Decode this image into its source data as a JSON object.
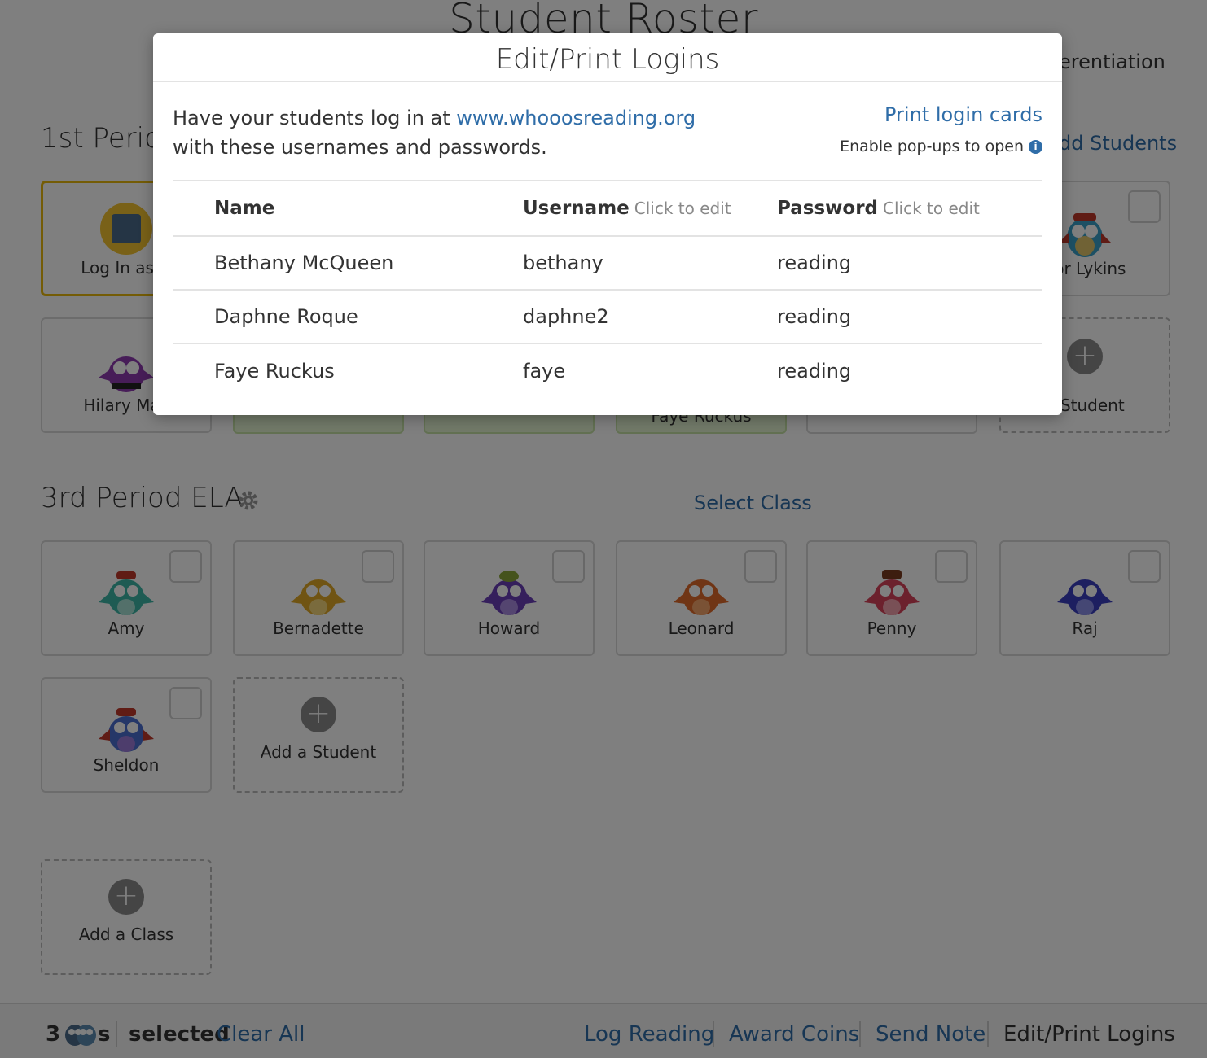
{
  "page": {
    "title": "Student Roster",
    "differentiation_link": "erentiation",
    "add_students_link": "dd Students",
    "select_class_link": "Select Class"
  },
  "classes": [
    {
      "name": "1st Perio",
      "cards": [
        {
          "label": "Log In as D",
          "type": "login-as"
        },
        {
          "label": "dor Lykins",
          "type": "student",
          "owl": "blue-red"
        },
        {
          "label": "Hilary Mac",
          "type": "student",
          "owl": "purple-hat"
        },
        {
          "label": "a Student",
          "type": "add"
        },
        {
          "label": "Faye Ruckus",
          "type": "student-green"
        }
      ]
    },
    {
      "name": "3rd Period ELA",
      "cards": [
        {
          "label": "Amy",
          "type": "student",
          "owl": "teal"
        },
        {
          "label": "Bernadette",
          "type": "student",
          "owl": "yellow"
        },
        {
          "label": "Howard",
          "type": "student",
          "owl": "purple"
        },
        {
          "label": "Leonard",
          "type": "student",
          "owl": "orange"
        },
        {
          "label": "Penny",
          "type": "student",
          "owl": "pink"
        },
        {
          "label": "Raj",
          "type": "student",
          "owl": "blue"
        },
        {
          "label": "Sheldon",
          "type": "student",
          "owl": "blue-red"
        },
        {
          "label": "Add a Student",
          "type": "add"
        }
      ]
    }
  ],
  "add_class_label": "Add a Class",
  "toolbar": {
    "count": "3",
    "owls_suffix": "s",
    "selected_label": "selected",
    "clear_all": "Clear All",
    "actions": [
      "Log Reading",
      "Award Coins",
      "Send Note",
      "Edit/Print Logins"
    ],
    "active_action": "Edit/Print Logins"
  },
  "modal": {
    "title": "Edit/Print Logins",
    "intro_prefix": "Have your students log in at ",
    "intro_link": "www.whooosreading.org",
    "intro_suffix": "with these usernames and passwords.",
    "print_link": "Print login cards",
    "popup_note": "Enable pop-ups to open",
    "info_icon": "info-icon",
    "table": {
      "headers": {
        "name": "Name",
        "username": "Username",
        "password": "Password",
        "edit_hint": "Click to edit"
      },
      "rows": [
        {
          "name": "Bethany McQueen",
          "username": "bethany",
          "password": "reading"
        },
        {
          "name": "Daphne Roque",
          "username": "daphne2",
          "password": "reading"
        },
        {
          "name": "Faye Ruckus",
          "username": "faye",
          "password": "reading"
        }
      ]
    }
  },
  "colors": {
    "link": "#2f6da8",
    "overlay": "rgba(0,0,0,0.5)",
    "highlight_border": "#e9b80c",
    "green_card": "#e5f5d3"
  }
}
